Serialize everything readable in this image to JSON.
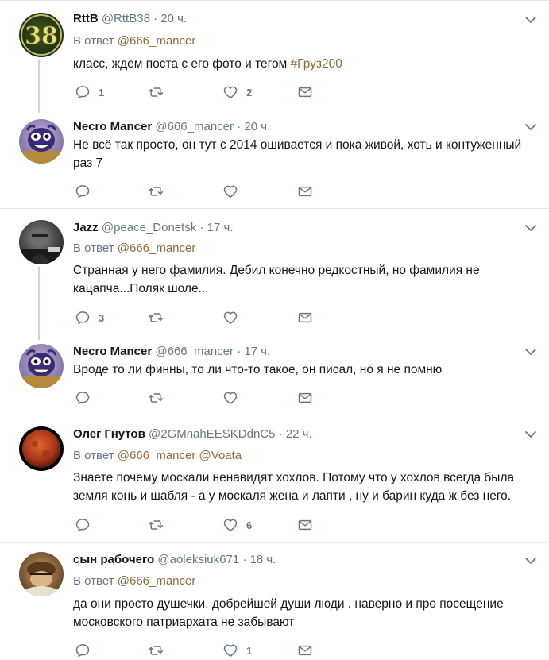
{
  "tweets": [
    {
      "name": "RttB",
      "handle": "@RttB38",
      "time": "20 ч.",
      "reply_prefix": "В ответ",
      "reply_to": "@666_mancer",
      "reply_to2": "",
      "text": "класс, ждем поста с его фото и тегом ",
      "hashtag": "#Груз200",
      "replies": "1",
      "retweets": "",
      "likes": "2",
      "avatar_text": "38"
    },
    {
      "name": "Necro Mancer",
      "handle": "@666_mancer",
      "time": "20 ч.",
      "text": "Не всё так просто, он тут с 2014  ошивается и пока живой, хоть и контуженный раз 7",
      "replies": "",
      "retweets": "",
      "likes": ""
    },
    {
      "name": "Jazz",
      "handle": "@peace_Donetsk",
      "time": "17 ч.",
      "reply_prefix": "В ответ",
      "reply_to": "@666_mancer",
      "text": "Странная у него фамилия.  Дебил конечно редкостный, но фамилия не кацапча...Поляк шоле...",
      "replies": "3",
      "retweets": "",
      "likes": ""
    },
    {
      "name": "Necro Mancer",
      "handle": "@666_mancer",
      "time": "17 ч.",
      "text": "Вроде то ли финны, то ли что-то такое, он писал, но я не помню",
      "replies": "",
      "retweets": "",
      "likes": ""
    },
    {
      "name": "Олег Гнутов",
      "handle": "@2GMnahEESKDdnC5",
      "time": "22 ч.",
      "reply_prefix": "В ответ",
      "reply_to": "@666_mancer",
      "reply_to2": "@Voata",
      "text": "Знаете почему москали ненавидят хохлов. Потому что у хохлов всегда была земля конь и шабля - а у москаля жена и лапти , ну и барин куда ж без него.",
      "replies": "",
      "retweets": "",
      "likes": "6"
    },
    {
      "name": "сын рабочего",
      "handle": "@aoleksiuk671",
      "time": "18 ч.",
      "reply_prefix": "В ответ",
      "reply_to": "@666_mancer",
      "text": "да они просто душечки. добрейшей души люди . наверно и про посещение московского патриархата не забывают",
      "replies": "",
      "retweets": "",
      "likes": "1"
    }
  ],
  "dot": "·",
  "colors": {
    "link": "#8a6d3b",
    "icon": "#657786",
    "separator": "#e6ecf0"
  },
  "icons": [
    "reply-icon",
    "retweet-icon",
    "like-icon",
    "direct-message-icon",
    "chevron-down-icon"
  ]
}
